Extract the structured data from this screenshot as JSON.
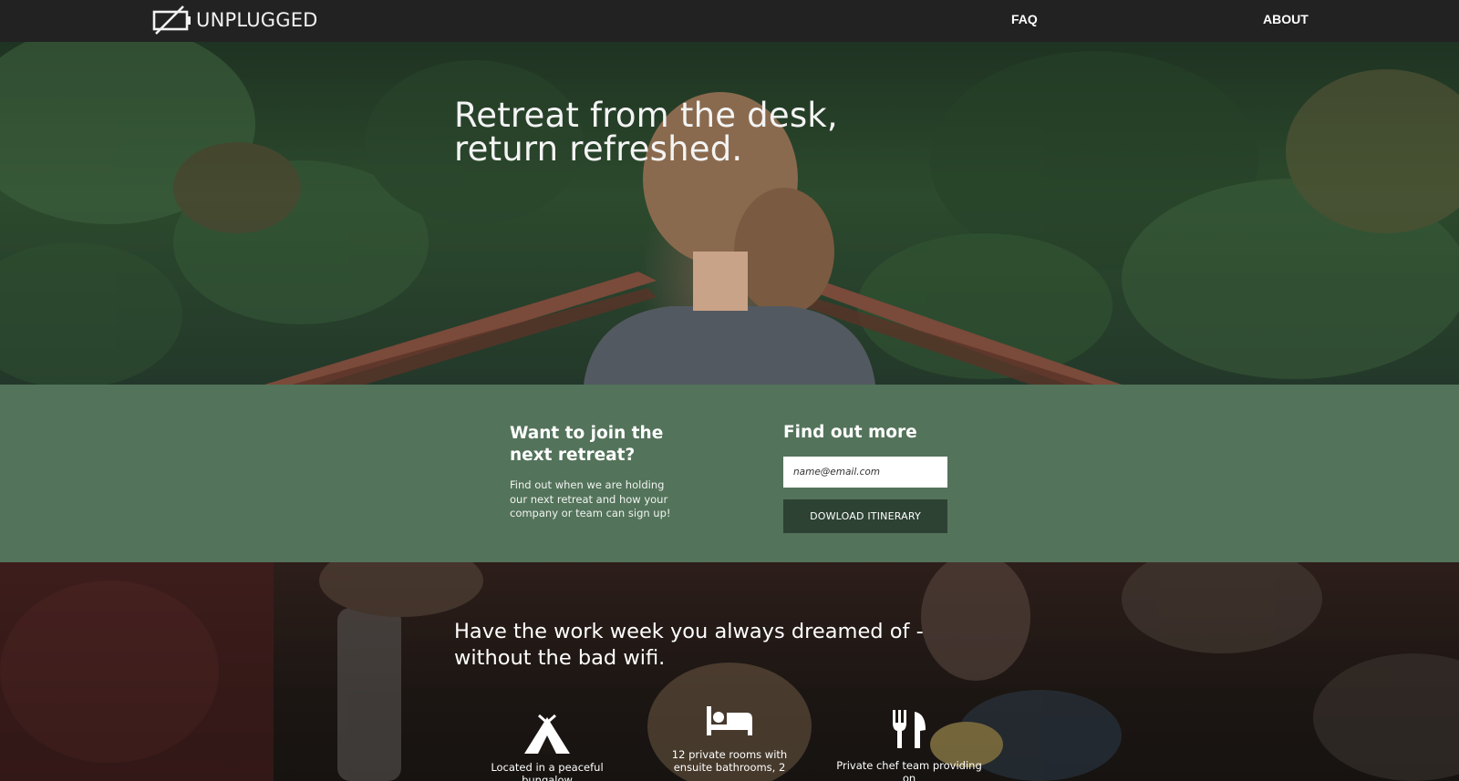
{
  "brand": {
    "name": "UNPLUGGED",
    "logo_icon": "battery-off-icon"
  },
  "nav": {
    "items": [
      {
        "label": "FAQ"
      },
      {
        "label": "ABOUT"
      }
    ]
  },
  "hero": {
    "line1": "Retreat from the desk,",
    "line2": "return refreshed."
  },
  "signup": {
    "heading_line1": "Want to join the",
    "heading_line2": "next retreat?",
    "body": "Find out when we are holding our next retreat and how your company or team can sign up!",
    "form_heading": "Find out more",
    "email_placeholder": "name@email.com",
    "button_label": "DOWLOAD ITINERARY"
  },
  "features": {
    "title_line1": "Have the work week you always dreamed of -",
    "title_line2": "without the bad wifi.",
    "items": [
      {
        "icon": "tent-icon",
        "text": "Located in a peaceful bungalow"
      },
      {
        "icon": "bed-icon",
        "text_line1": "12 private rooms with",
        "text_line2": "ensuite bathrooms, 2"
      },
      {
        "icon": "utensils-icon",
        "text": "Private chef team providing on"
      }
    ]
  },
  "colors": {
    "nav": "#222222",
    "band": "#53735a",
    "button": "#2d4233"
  }
}
